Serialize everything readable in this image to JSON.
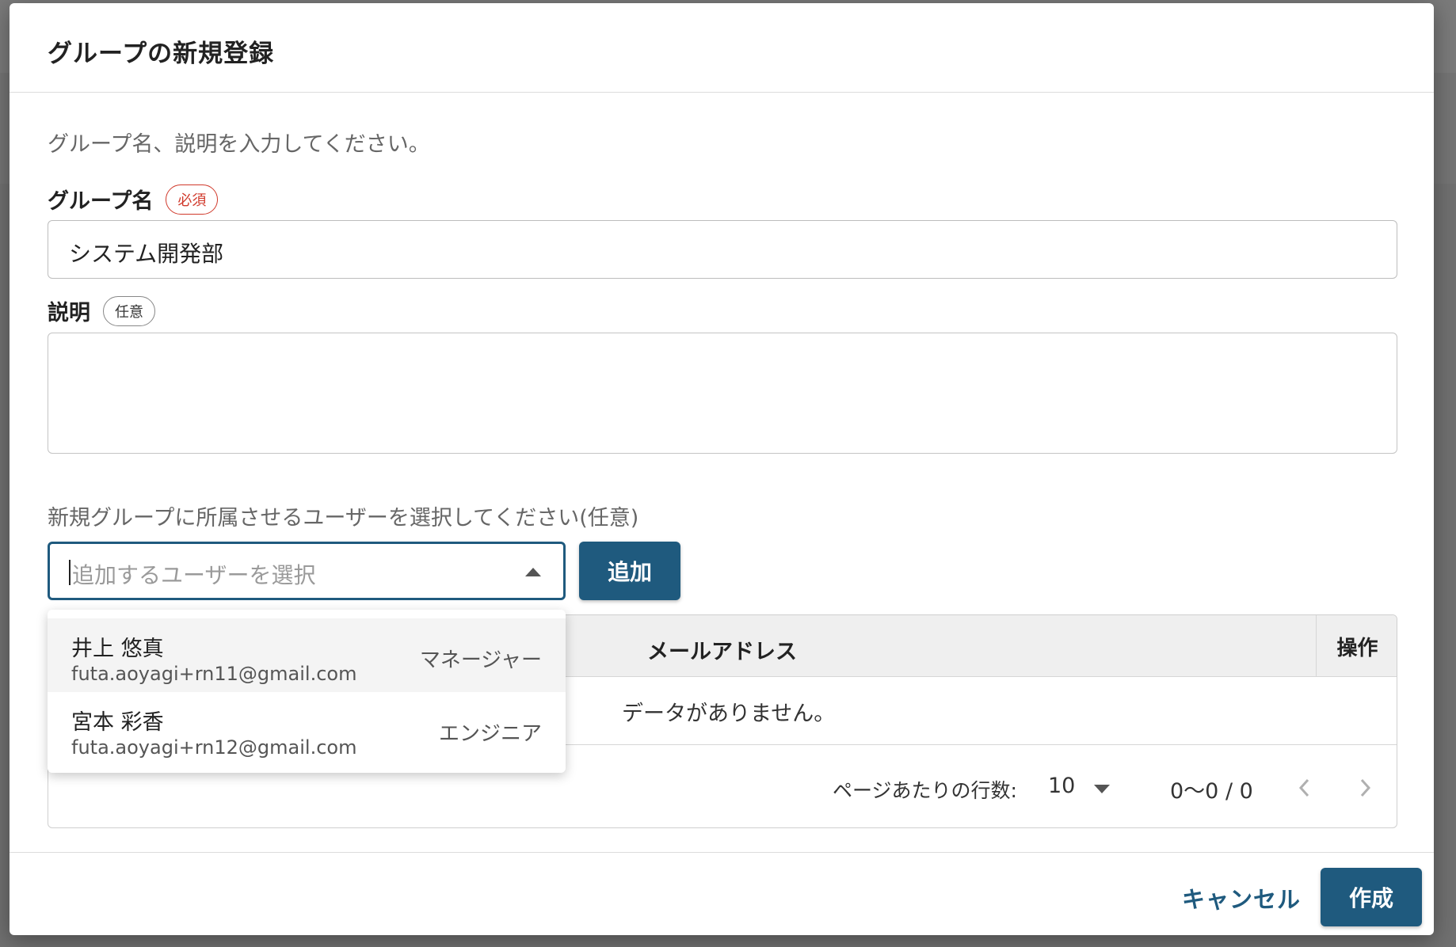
{
  "dialog": {
    "title": "グループの新規登録",
    "instruction": "グループ名、説明を入力してください。"
  },
  "group_name": {
    "label": "グループ名",
    "badge": "必須",
    "value": "システム開発部"
  },
  "description": {
    "label": "説明",
    "badge": "任意",
    "value": ""
  },
  "members": {
    "section_label": "新規グループに所属させるユーザーを選択してください(任意)",
    "select_placeholder": "追加するユーザーを選択",
    "add_button": "追加",
    "dropdown_options": [
      {
        "name": "井上 悠真",
        "email": "futa.aoyagi+rn11@gmail.com",
        "role": "マネージャー"
      },
      {
        "name": "宮本 彩香",
        "email": "futa.aoyagi+rn12@gmail.com",
        "role": "エンジニア"
      }
    ],
    "table": {
      "columns": [
        "メールアドレス",
        "操作"
      ],
      "empty_message": "データがありません。"
    },
    "pagination": {
      "rows_per_page_label": "ページあたりの行数:",
      "rows_per_page": "10",
      "range": "0〜0 / 0"
    }
  },
  "footer": {
    "cancel_label": "キャンセル",
    "create_label": "作成"
  },
  "colors": {
    "primary": "#1f5a7e",
    "required": "#d0392b"
  }
}
